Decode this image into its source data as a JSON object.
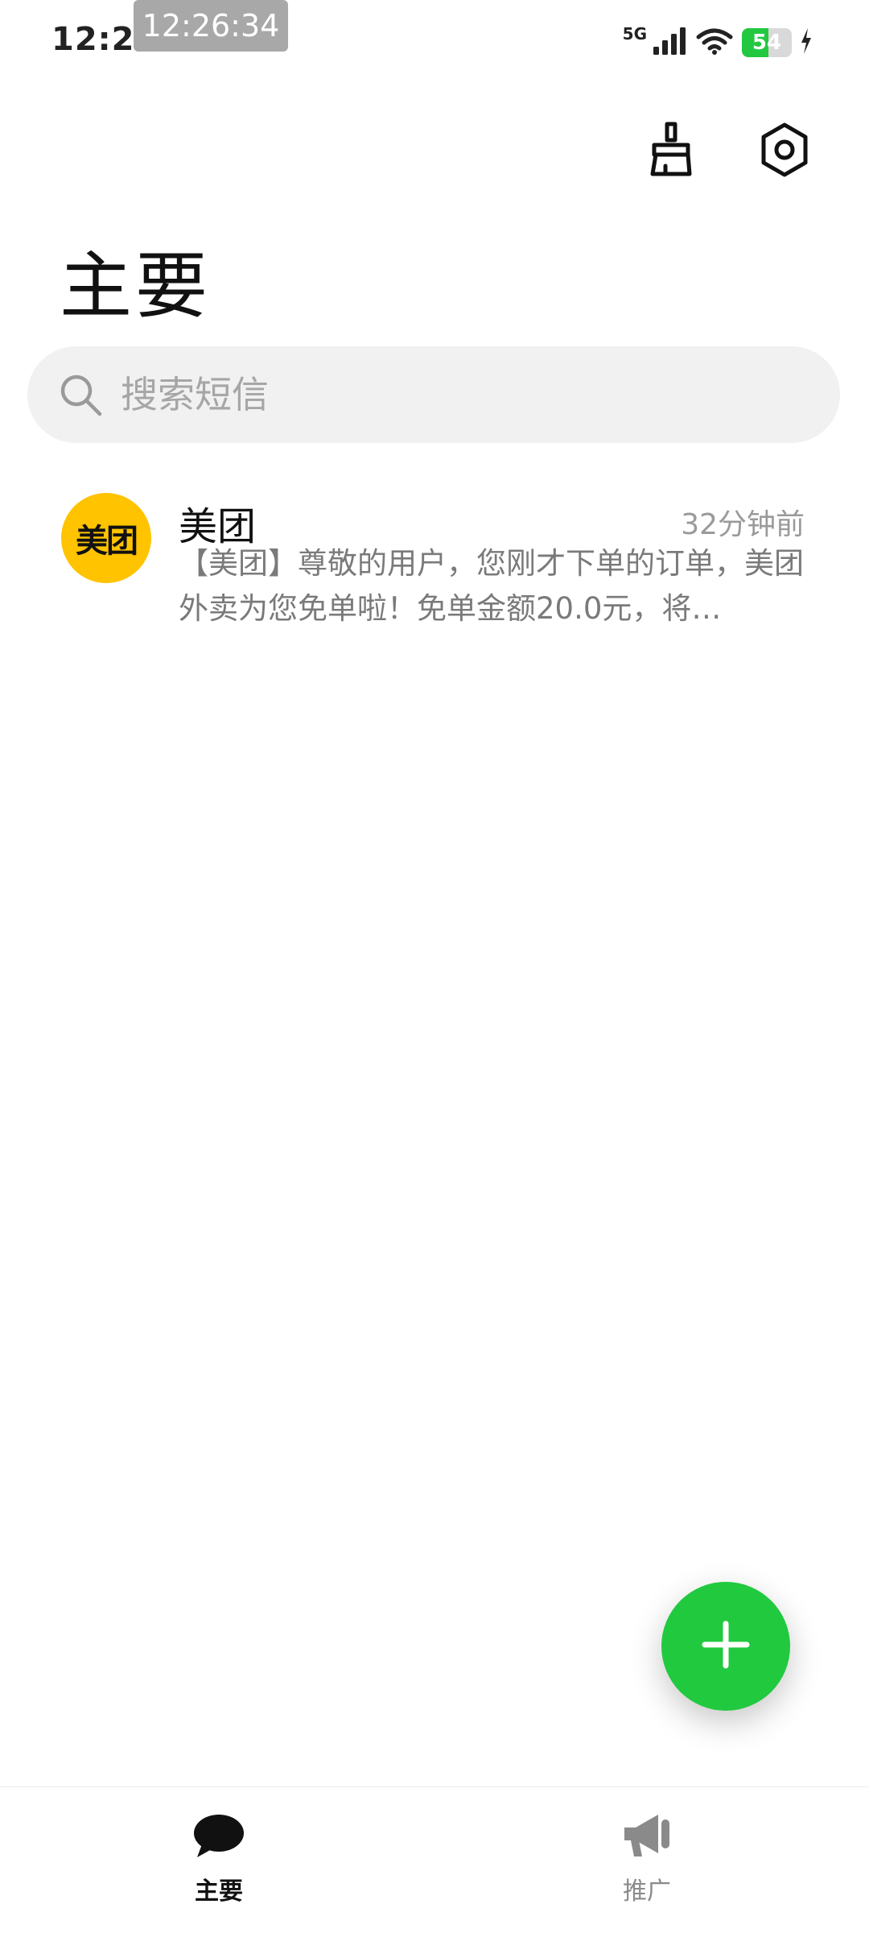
{
  "status_bar": {
    "time": "12:26",
    "overlay_time": "12:26:34",
    "network": "5G",
    "battery_level": "54",
    "battery_fraction": 0.54,
    "charging": true
  },
  "header": {
    "title": "主要",
    "actions": [
      {
        "icon": "broom-icon"
      },
      {
        "icon": "settings-hexagon-icon"
      }
    ]
  },
  "search": {
    "placeholder": "搜索短信"
  },
  "conversations": [
    {
      "avatar_text": "美团",
      "avatar_color": "#ffc300",
      "name": "美团",
      "time": "32分钟前",
      "preview": "【美团】尊敬的用户，您刚才下单的订单，美团外卖为您免单啦！免单金额20.0元，将…"
    }
  ],
  "fab": {
    "icon": "plus-icon",
    "color": "#21c93f"
  },
  "bottom_nav": {
    "items": [
      {
        "label": "主要",
        "icon": "chat-bubble-icon",
        "active": true
      },
      {
        "label": "推广",
        "icon": "megaphone-icon",
        "active": false
      }
    ]
  },
  "colors": {
    "accent": "#21c93f",
    "battery": "#22c840",
    "search_bg": "#f1f1f1"
  }
}
